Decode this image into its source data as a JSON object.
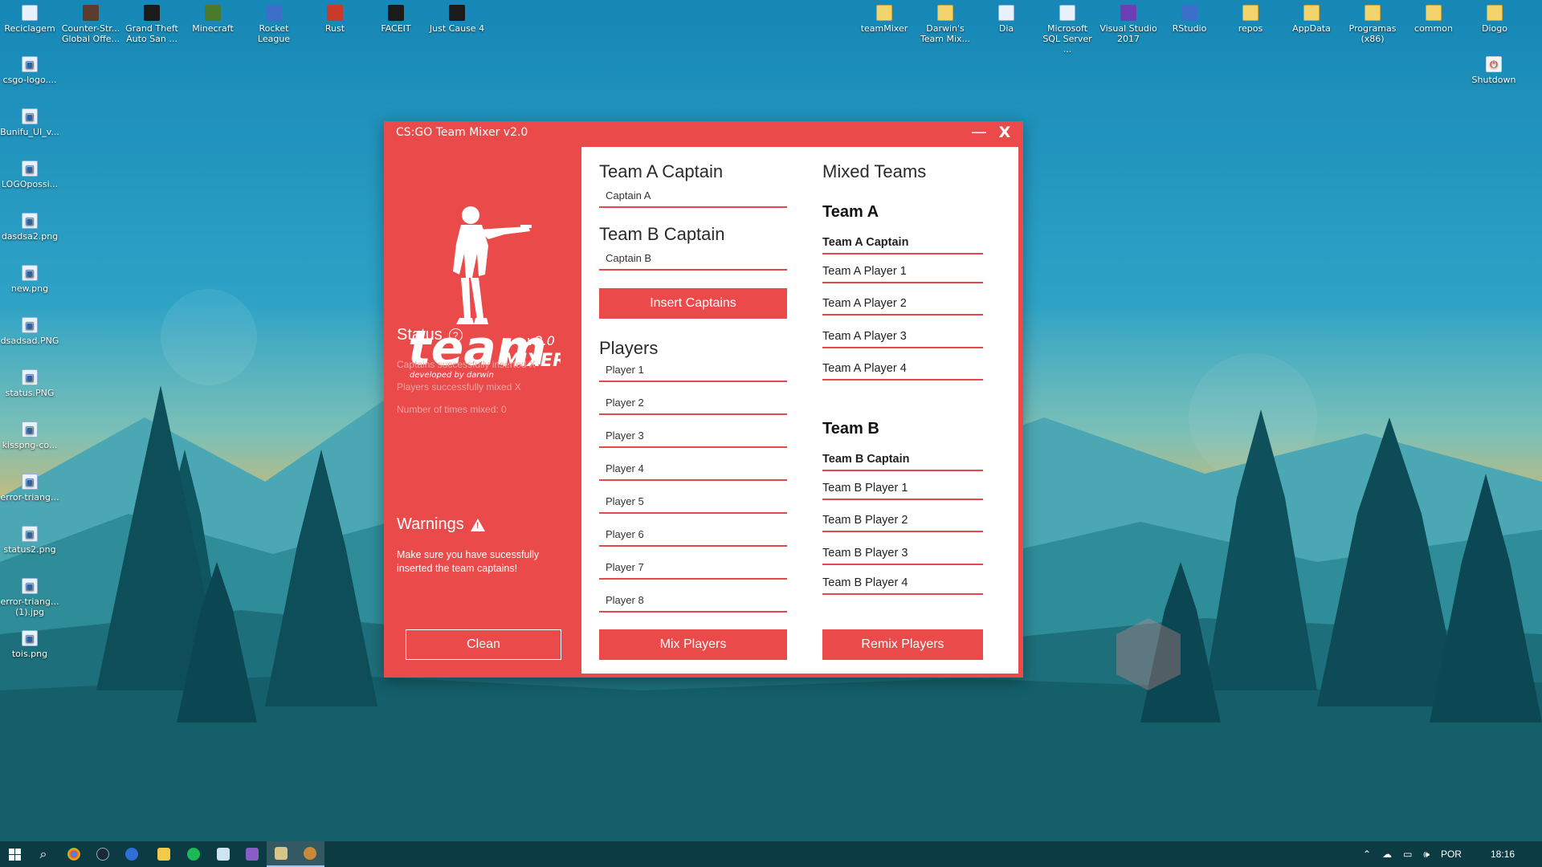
{
  "desktop": {
    "icons_top": [
      {
        "label": "Reciclagem",
        "icon": "recycle-bin-icon",
        "style": "ic-file"
      },
      {
        "label": "Counter-Str... Global Offe...",
        "icon": "csgo-icon",
        "style": "ic-app"
      },
      {
        "label": "Grand Theft Auto San ...",
        "icon": "gta-icon",
        "style": "ic-dark"
      },
      {
        "label": "Minecraft",
        "icon": "minecraft-icon",
        "style": "ic-green"
      },
      {
        "label": "Rocket League",
        "icon": "rocket-league-icon",
        "style": "ic-blue"
      },
      {
        "label": "Rust",
        "icon": "rust-icon",
        "style": "ic-red"
      },
      {
        "label": "FACEIT",
        "icon": "faceit-icon",
        "style": "ic-dark"
      },
      {
        "label": "Just Cause 4",
        "icon": "just-cause-icon",
        "style": "ic-dark"
      },
      {
        "label": "teamMixer",
        "icon": "folder-icon",
        "style": "ic-folder"
      },
      {
        "label": "Darwin's Team Mix...",
        "icon": "folder-icon",
        "style": "ic-folder"
      },
      {
        "label": "Dia",
        "icon": "dia-icon",
        "style": "ic-file"
      },
      {
        "label": "Microsoft SQL Server ...",
        "icon": "sql-server-icon",
        "style": "ic-file"
      },
      {
        "label": "Visual Studio 2017",
        "icon": "visual-studio-icon",
        "style": "ic-vs"
      },
      {
        "label": "RStudio",
        "icon": "rstudio-icon",
        "style": "ic-blue"
      },
      {
        "label": "repos",
        "icon": "folder-icon",
        "style": "ic-folder"
      },
      {
        "label": "AppData",
        "icon": "folder-icon",
        "style": "ic-folder"
      },
      {
        "label": "Programas (x86)",
        "icon": "folder-icon",
        "style": "ic-folder"
      },
      {
        "label": "common",
        "icon": "folder-icon",
        "style": "ic-folder"
      },
      {
        "label": "Diogo",
        "icon": "folder-icon",
        "style": "ic-folder"
      }
    ],
    "icons_left": [
      {
        "label": "csgo-logo....",
        "icon": "image-file-icon"
      },
      {
        "label": "Bunifu_UI_v...",
        "icon": "file-icon"
      },
      {
        "label": "LOGOpossi...",
        "icon": "image-file-icon"
      },
      {
        "label": "dasdsa2.png",
        "icon": "image-file-icon"
      },
      {
        "label": "new.png",
        "icon": "image-file-icon"
      },
      {
        "label": "dsadsad.PNG",
        "icon": "image-file-icon"
      },
      {
        "label": "status.PNG",
        "icon": "image-file-icon"
      },
      {
        "label": "kisspng-co...",
        "icon": "image-file-icon"
      },
      {
        "label": "error-triang...",
        "icon": "image-file-icon"
      },
      {
        "label": "status2.png",
        "icon": "image-file-icon"
      },
      {
        "label": "error-triang... (1).jpg",
        "icon": "image-file-icon"
      },
      {
        "label": "tois.png",
        "icon": "image-file-icon"
      }
    ],
    "shutdown": {
      "label": "Shutdown",
      "icon": "shutdown-icon"
    }
  },
  "window": {
    "title": "CS:GO Team Mixer v2.0",
    "minimize_symbol": "—",
    "close_symbol": "X",
    "logo": {
      "word1": "team",
      "word2": "MIXER",
      "version": "v2.0",
      "credit": "developed by darwin"
    },
    "status": {
      "heading": "Status",
      "lines": [
        "Captains successfully inserted X",
        "Players successfully mixed X",
        "Number of times mixed: 0"
      ]
    },
    "warnings": {
      "heading": "Warnings",
      "message": "Make sure you have sucessfully inserted the team captains!"
    },
    "clean_button": "Clean",
    "captains": {
      "team_a_heading": "Team A Captain",
      "team_a_value": "Captain A",
      "team_b_heading": "Team B Captain",
      "team_b_value": "Captain B",
      "insert_button": "Insert Captains"
    },
    "players": {
      "heading": "Players",
      "list": [
        "Player 1",
        "Player 2",
        "Player 3",
        "Player 4",
        "Player 5",
        "Player 6",
        "Player 7",
        "Player 8"
      ],
      "mix_button": "Mix Players"
    },
    "mixed": {
      "heading": "Mixed Teams",
      "team_a": {
        "title": "Team A",
        "captain": "Team A Captain",
        "players": [
          "Team A Player 1",
          "Team A Player 2",
          "Team A Player 3",
          "Team A Player 4"
        ]
      },
      "team_b": {
        "title": "Team B",
        "captain": "Team B Captain",
        "players": [
          "Team B Player 1",
          "Team B Player 2",
          "Team B Player 3",
          "Team B Player 4"
        ]
      },
      "remix_button": "Remix Players"
    },
    "accent_color": "#ea4a4a"
  },
  "taskbar": {
    "apps": [
      {
        "name": "start-icon"
      },
      {
        "name": "search-icon"
      },
      {
        "name": "chrome-icon"
      },
      {
        "name": "steam-icon"
      },
      {
        "name": "browser-icon"
      },
      {
        "name": "file-explorer-icon"
      },
      {
        "name": "spotify-icon"
      },
      {
        "name": "notepad-icon"
      },
      {
        "name": "visual-studio-icon"
      },
      {
        "name": "team-mixer-icon"
      },
      {
        "name": "steam-active-icon"
      }
    ],
    "language": "POR",
    "time": "18:16"
  }
}
